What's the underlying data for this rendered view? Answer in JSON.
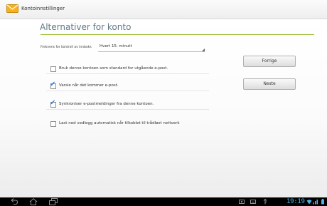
{
  "app": {
    "title": "Kontoinnstillinger",
    "icon": "email-envelope-icon"
  },
  "page": {
    "heading": "Alternativer for konto"
  },
  "frequency": {
    "label": "Frekvens for kontroll av innboks",
    "value": "Hvert 15. minutt"
  },
  "options": [
    {
      "label": "Bruk denne kontoen som standard for utgående e-post.",
      "checked": false
    },
    {
      "label": "Varsle når det kommer e-post.",
      "checked": true
    },
    {
      "label": "Synkroniser e-postmeldinger fra denne kontoen.",
      "checked": true
    },
    {
      "label": "Last ned vedlegg automatisk når tilkoblet til trådløst nettverk",
      "checked": false
    }
  ],
  "buttons": {
    "previous": "Forrige",
    "next": "Neste"
  },
  "statusbar": {
    "clock": "19:19",
    "icons": [
      "screenshot-icon",
      "keyboard-icon",
      "usb-icon",
      "wifi-icon",
      "signal-icon",
      "battery-icon"
    ]
  },
  "navbar": {
    "icons": [
      "back-icon",
      "home-icon",
      "recent-apps-icon"
    ]
  },
  "colors": {
    "heading": "#607a86",
    "accent": "#9cc13a",
    "checkmark": "#3a86d9",
    "clock": "#4fb5e6"
  }
}
